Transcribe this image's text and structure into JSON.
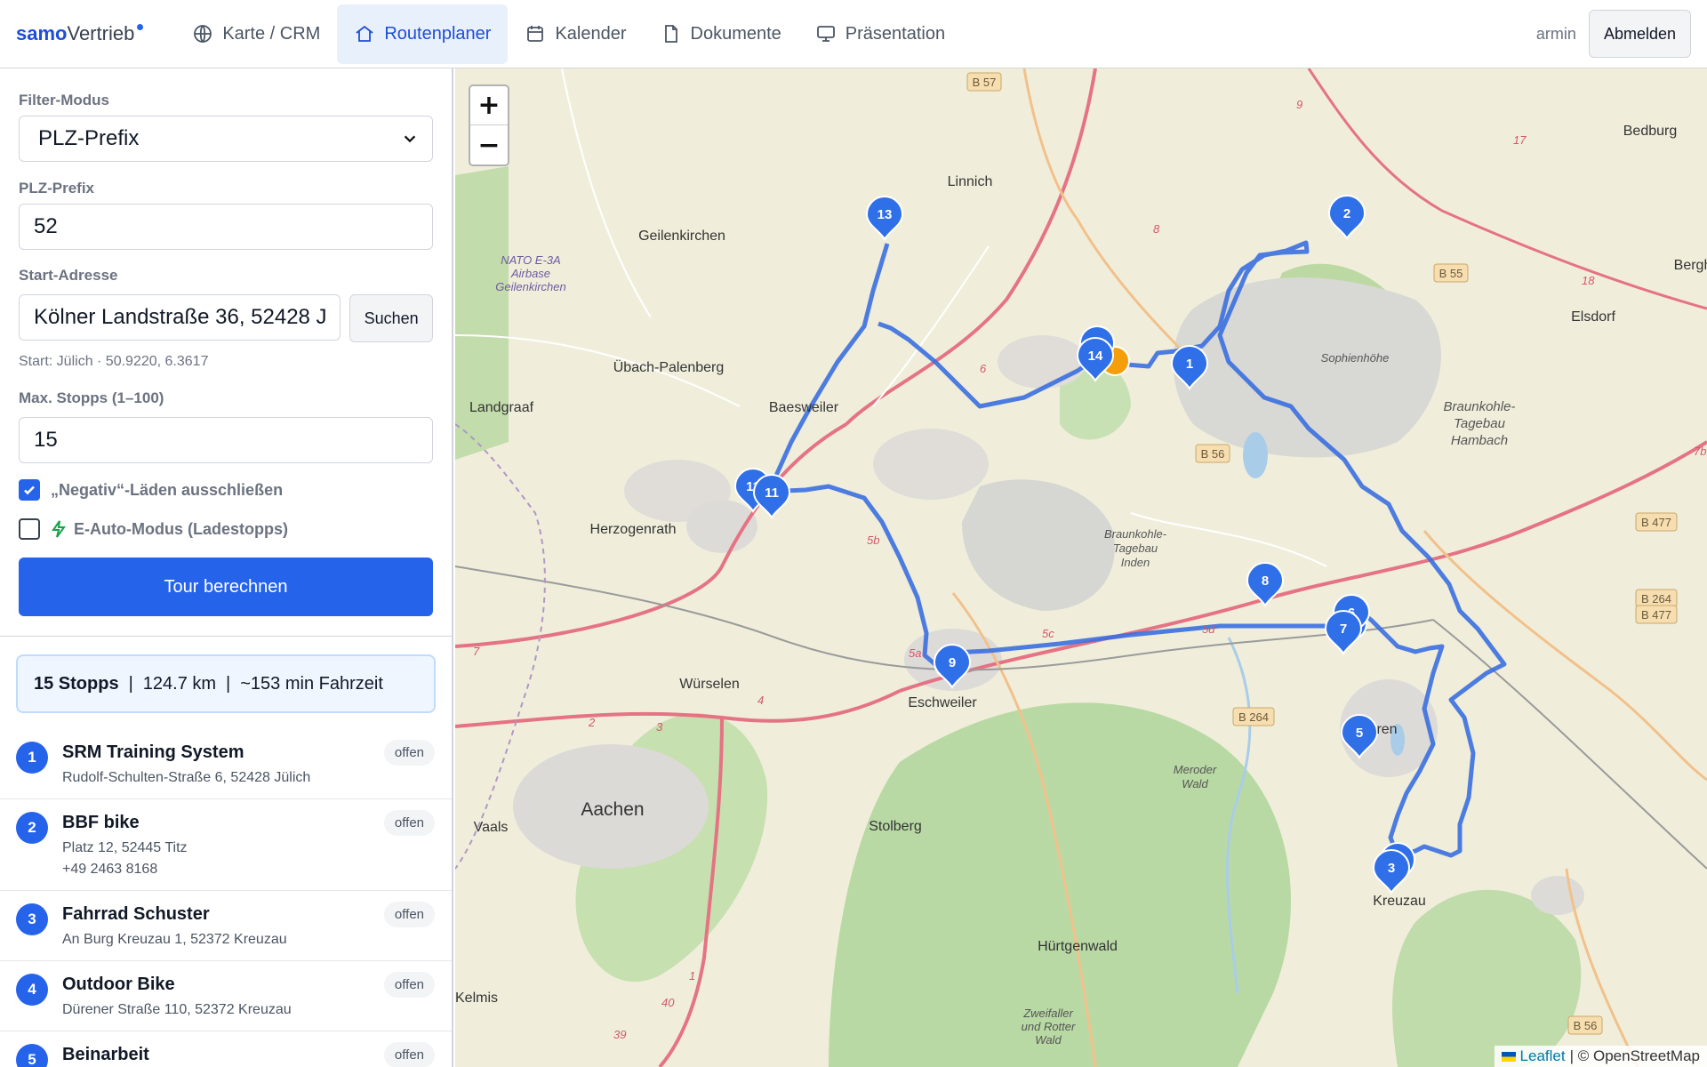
{
  "app": {
    "logo_bold": "samo",
    "logo_rest": "Vertrieb"
  },
  "nav": [
    {
      "label": "Karte / CRM",
      "icon": "globe-icon"
    },
    {
      "label": "Routenplaner",
      "icon": "home-icon",
      "active": true
    },
    {
      "label": "Kalender",
      "icon": "calendar-icon"
    },
    {
      "label": "Dokumente",
      "icon": "document-icon"
    },
    {
      "label": "Präsentation",
      "icon": "monitor-icon"
    }
  ],
  "user": {
    "name": "armin",
    "logout_label": "Abmelden"
  },
  "form": {
    "filter_mode_label": "Filter-Modus",
    "filter_mode_value": "PLZ-Prefix",
    "plz_label": "PLZ-Prefix",
    "plz_value": "52",
    "start_label": "Start-Adresse",
    "start_value": "Kölner Landstraße 36, 52428 J",
    "search_label": "Suchen",
    "start_hint": "Start: Jülich · 50.9220, 6.3617",
    "max_stops_label": "Max. Stopps (1–100)",
    "max_stops_value": "15",
    "exclude_negative_label": "„Negativ“-Läden ausschließen",
    "exclude_negative_checked": true,
    "ev_mode_label": "E-Auto-Modus (Ladestopps)",
    "ev_mode_checked": false,
    "calc_label": "Tour berechnen"
  },
  "summary": {
    "stops": "15 Stopps",
    "distance": "124.7 km",
    "time": "~153 min Fahrzeit",
    "separator": "|"
  },
  "stops": [
    {
      "num": "1",
      "name": "SRM Training System",
      "address": "Rudolf-Schulten-Straße 6, 52428 Jülich",
      "phone": "",
      "status": "offen"
    },
    {
      "num": "2",
      "name": "BBF bike",
      "address": "Platz 12, 52445 Titz",
      "phone": "+49 2463 8168",
      "status": "offen"
    },
    {
      "num": "3",
      "name": "Fahrrad Schuster",
      "address": "An Burg Kreuzau 1, 52372 Kreuzau",
      "phone": "",
      "status": "offen"
    },
    {
      "num": "4",
      "name": "Outdoor Bike",
      "address": "Dürener Straße 110, 52372 Kreuzau",
      "phone": "",
      "status": "offen"
    },
    {
      "num": "5",
      "name": "Beinarbeit",
      "address": "",
      "phone": "",
      "status": "offen"
    }
  ],
  "map": {
    "zoom_in": "+",
    "zoom_out": "−",
    "attribution_link": "Leaflet",
    "attribution_text": "| © OpenStreetMap",
    "route_color": "#3b6fe0",
    "marker_color": "#2f6fe8",
    "start_marker_color": "#f59e0b",
    "places": [
      "Linnich",
      "Geilenkirchen",
      "NATO E-3A",
      "Airbase",
      "Geilenkirchen",
      "Übach-Palenberg",
      "Baesweiler",
      "Landgraaf",
      "Herzogenrath",
      "Würselen",
      "Aachen",
      "Vaals",
      "Stolberg",
      "Eschweiler",
      "Kreuzau",
      "Bedburg",
      "Elsdorf",
      "Sophienhöhe",
      "Braunkohle-",
      "Tagebau",
      "Hambach",
      "Braunkohle-",
      "Tagebau",
      "Inden",
      "Meroder",
      "Wald",
      "Hürtgenwald",
      "Zweifaller",
      "und Rotter",
      "Wald",
      "Kelmis",
      "ren",
      "Bergh"
    ],
    "roads": [
      "B 57",
      "B 55",
      "B 56",
      "B 264",
      "B 477",
      "B 264",
      "B 477",
      "B 56",
      "17",
      "18",
      "9",
      "8",
      "7",
      "6",
      "5b",
      "5a",
      "5d",
      "5c",
      "4",
      "3",
      "2",
      "39",
      "40",
      "1",
      "7b"
    ],
    "markers": [
      "13",
      "2",
      "14",
      "1",
      "11",
      "11",
      "8",
      "6",
      "7",
      "9",
      "5",
      "3"
    ]
  }
}
